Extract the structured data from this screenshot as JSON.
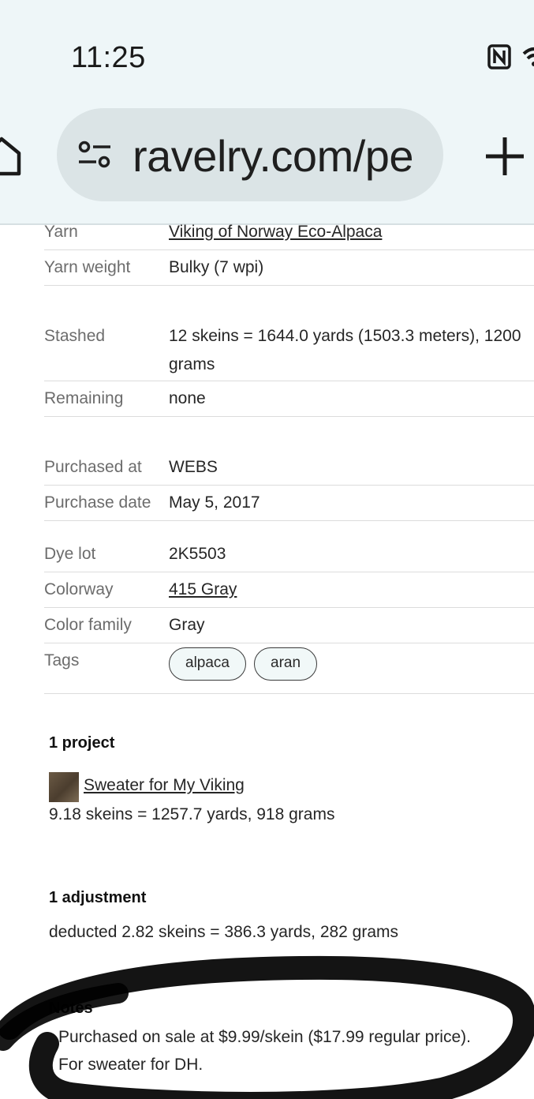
{
  "status_bar": {
    "time": "11:25"
  },
  "browser": {
    "url": "ravelry.com/pe"
  },
  "details": [
    {
      "label": "Yarn",
      "value": "Viking of Norway Eco-Alpaca",
      "link": true
    },
    {
      "label": "Yarn weight",
      "value": "Bulky (7 wpi)"
    },
    {
      "label": "Stashed",
      "value": "12 skeins = 1644.0 yards (1503.3 meters), 1200",
      "value_line2": "grams"
    },
    {
      "label": "Remaining",
      "value": "none"
    },
    {
      "label": "Purchased at",
      "value": "WEBS"
    },
    {
      "label": "Purchase date",
      "value": "May 5, 2017"
    },
    {
      "label": "Dye lot",
      "value": "2K5503"
    },
    {
      "label": "Colorway",
      "value": "415 Gray",
      "link": true
    },
    {
      "label": "Color family",
      "value": "Gray"
    },
    {
      "label": "Tags",
      "tags": [
        "alpaca",
        "aran"
      ]
    }
  ],
  "projects": {
    "title": "1 project",
    "items": [
      {
        "name": "Sweater for My Viking",
        "usage": "9.18 skeins = 1257.7 yards, 918 grams"
      }
    ]
  },
  "adjustments": {
    "title": "1 adjustment",
    "text": "deducted 2.82 skeins = 386.3 yards, 282 grams"
  },
  "notes": {
    "title": "Notes",
    "line1": "Purchased on sale at $9.99/skein ($17.99 regular price).",
    "line2": "For sweater for DH."
  }
}
